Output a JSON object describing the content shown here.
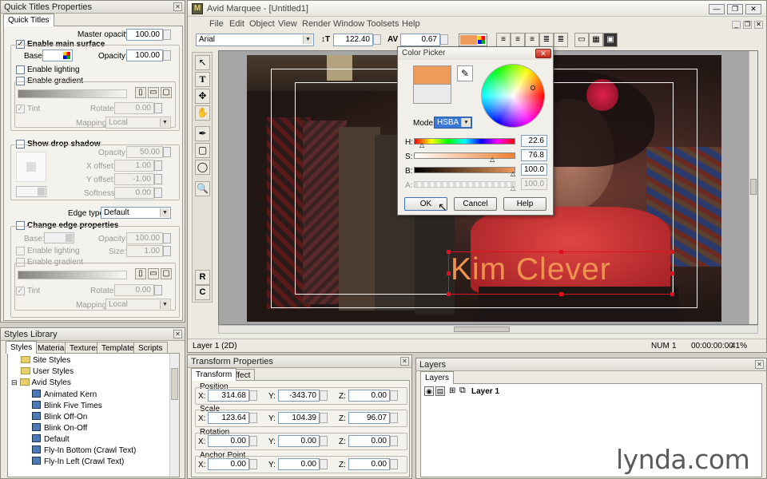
{
  "app": {
    "title": "Avid Marquee - [Untitled1]",
    "menu": [
      "File",
      "Edit",
      "Object",
      "View",
      "Render",
      "Window",
      "Toolsets",
      "Help"
    ],
    "watermark": "lynda.com"
  },
  "toolbar": {
    "font": "Arial",
    "font_size": "122.40",
    "kerning": "0.67"
  },
  "qtp": {
    "title": "Quick Titles Properties",
    "tab": "Quick Titles",
    "master_opacity_label": "Master opacity:",
    "master_opacity": "100.00",
    "enable_main_surface": "Enable main surface",
    "base_label": "Base:",
    "opacity_label": "Opacity:",
    "opacity": "100.00",
    "enable_lighting": "Enable lighting",
    "enable_gradient": "Enable gradient",
    "tint": "Tint",
    "rotate_label": "Rotate:",
    "rotate": "0.00",
    "mapping_label": "Mapping:",
    "mapping": "Local",
    "show_drop_shadow": "Show drop shadow",
    "shadow_opacity": "50.00",
    "x_offset_label": "X offset:",
    "x_offset": "1.00",
    "y_offset_label": "Y offset:",
    "y_offset": "-1.00",
    "softness_label": "Softness:",
    "softness": "0.00",
    "edge_type_label": "Edge type:",
    "edge_type": "Default",
    "change_edge": "Change edge properties",
    "edge_opacity": "100.00",
    "size_label": "Size:",
    "size": "1.00",
    "edge_rotate": "0.00",
    "edge_mapping": "Local"
  },
  "styles": {
    "title": "Styles Library",
    "tabs": [
      "Styles",
      "Materials",
      "Textures",
      "Templates",
      "Scripts"
    ],
    "folders": [
      "Site Styles",
      "User Styles",
      "Avid Styles"
    ],
    "items": [
      "Animated Kern",
      "Blink Five Times",
      "Blink Off-On",
      "Blink On-Off",
      "Default",
      "Fly-In Bottom (Crawl Text)",
      "Fly-In Left (Crawl Text)"
    ]
  },
  "canvas": {
    "title_text": "Kim Clever"
  },
  "status": {
    "layer": "Layer 1 (2D)",
    "num": "NUM",
    "field": "1",
    "time": "00:00:00:00",
    "zoom": "41%"
  },
  "transform": {
    "title": "Transform Properties",
    "tabs": [
      "Transform",
      "Effect"
    ],
    "position_label": "Position",
    "pos_x": "314.68",
    "pos_y": "-343.70",
    "pos_z": "0.00",
    "scale_label": "Scale",
    "scale_x": "123.64",
    "scale_y": "104.39",
    "scale_z": "96.07",
    "rotation_label": "Rotation",
    "rot_x": "0.00",
    "rot_y": "0.00",
    "rot_z": "0.00",
    "anchor_label": "Anchor Point",
    "anc_x": "0.00",
    "anc_y": "0.00",
    "anc_z": "0.00",
    "x": "X:",
    "y": "Y:",
    "z": "Z:"
  },
  "layers": {
    "title": "Layers",
    "tab": "Layers",
    "item": "Layer 1"
  },
  "picker": {
    "title": "Color Picker",
    "mode_label": "Mode:",
    "mode": "HSBA",
    "h_label": "H:",
    "h": "22.6",
    "s_label": "S:",
    "s": "76.8",
    "b_label": "B:",
    "b": "100.0",
    "a_label": "A:",
    "a": "100.0",
    "ok": "OK",
    "cancel": "Cancel",
    "help": "Help",
    "new_color": "#ee9a5a",
    "old_color": "#ebebeb"
  },
  "colors": {
    "accent": "#ee9a5a",
    "title_text": "#ee9250",
    "selection": "#e01020"
  }
}
